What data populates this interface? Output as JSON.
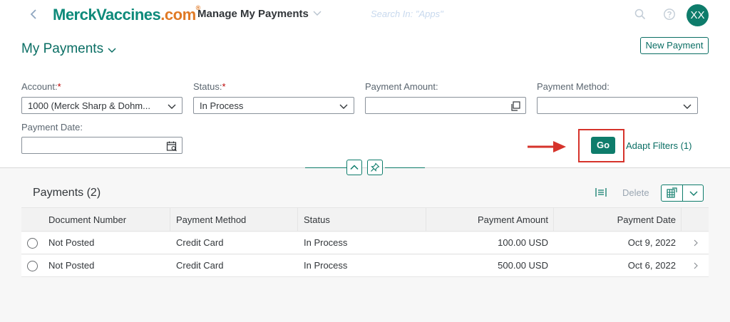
{
  "shell": {
    "logo_main": "MerckVaccines",
    "logo_dot": ".com",
    "logo_reg": "®",
    "app_title": "Manage My Payments",
    "search_placeholder": "Search In: \"Apps\"",
    "avatar_initials": "XX"
  },
  "header": {
    "variant_title": "My Payments",
    "new_payment_label": "New Payment"
  },
  "filters": {
    "account": {
      "label": "Account:",
      "required": "*",
      "value": "1000 (Merck Sharp & Dohm..."
    },
    "status": {
      "label": "Status:",
      "required": "*",
      "value": "In Process"
    },
    "payment_amount": {
      "label": "Payment Amount:",
      "value": ""
    },
    "payment_method": {
      "label": "Payment Method:",
      "value": ""
    },
    "payment_date": {
      "label": "Payment Date:",
      "value": ""
    },
    "go_label": "Go",
    "adapt_filters_label": "Adapt Filters (1)"
  },
  "table": {
    "title": "Payments (2)",
    "delete_label": "Delete",
    "columns": [
      "Document Number",
      "Payment Method",
      "Status",
      "Payment Amount",
      "Payment Date"
    ],
    "rows": [
      {
        "document_number": "Not Posted",
        "payment_method": "Credit Card",
        "status": "In Process",
        "amount": "100.00 USD",
        "date": "Oct 9, 2022"
      },
      {
        "document_number": "Not Posted",
        "payment_method": "Credit Card",
        "status": "In Process",
        "amount": "500.00 USD",
        "date": "Oct 6, 2022"
      }
    ]
  },
  "colors": {
    "brand_teal": "#0e7c6b",
    "link_teal": "#0a6e64",
    "highlight_red": "#d6332b",
    "logo_orange": "#e07a26"
  },
  "icons": {
    "back": "chevron-left-icon",
    "search": "search-icon",
    "help": "help-icon",
    "dropdown": "chevron-down-icon",
    "value_help": "value-help-icon",
    "calendar": "calendar-icon",
    "collapse": "chevron-up-icon",
    "pin": "pin-icon",
    "settings": "table-settings-icon",
    "export": "export-icon",
    "row_nav": "chevron-right-icon"
  }
}
